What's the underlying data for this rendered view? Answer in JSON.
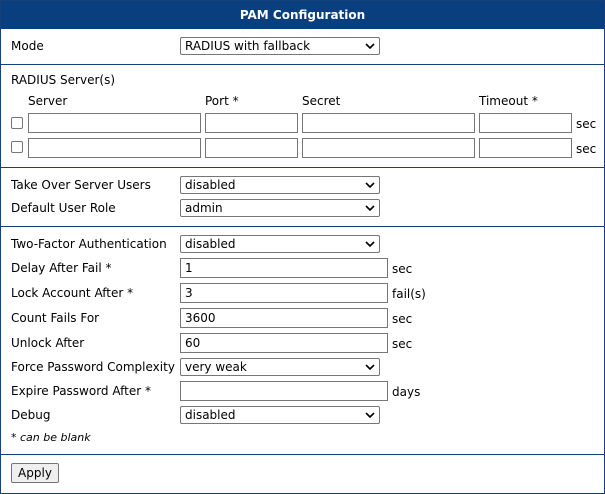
{
  "title": "PAM Configuration",
  "mode": {
    "label": "Mode",
    "value": "RADIUS with fallback"
  },
  "radius": {
    "section_label": "RADIUS Server(s)",
    "headers": {
      "server": "Server",
      "port": "Port *",
      "secret": "Secret",
      "timeout": "Timeout *"
    },
    "rows": [
      {
        "server": "",
        "port": "",
        "secret": "",
        "timeout": "",
        "unit": "sec"
      },
      {
        "server": "",
        "port": "",
        "secret": "",
        "timeout": "",
        "unit": "sec"
      }
    ]
  },
  "take_over": {
    "label": "Take Over Server Users",
    "value": "disabled"
  },
  "default_role": {
    "label": "Default User Role",
    "value": "admin"
  },
  "two_factor": {
    "label": "Two-Factor Authentication",
    "value": "disabled"
  },
  "delay_after_fail": {
    "label": "Delay After Fail *",
    "value": "1",
    "unit": "sec"
  },
  "lock_account_after": {
    "label": "Lock Account After *",
    "value": "3",
    "unit": "fail(s)"
  },
  "count_fails_for": {
    "label": "Count Fails For",
    "value": "3600",
    "unit": "sec"
  },
  "unlock_after": {
    "label": "Unlock After",
    "value": "60",
    "unit": "sec"
  },
  "force_complexity": {
    "label": "Force Password Complexity",
    "value": "very weak"
  },
  "expire_password": {
    "label": "Expire Password After *",
    "value": "",
    "unit": "days"
  },
  "debug": {
    "label": "Debug",
    "value": "disabled"
  },
  "note": "* can be blank",
  "apply_label": "Apply"
}
